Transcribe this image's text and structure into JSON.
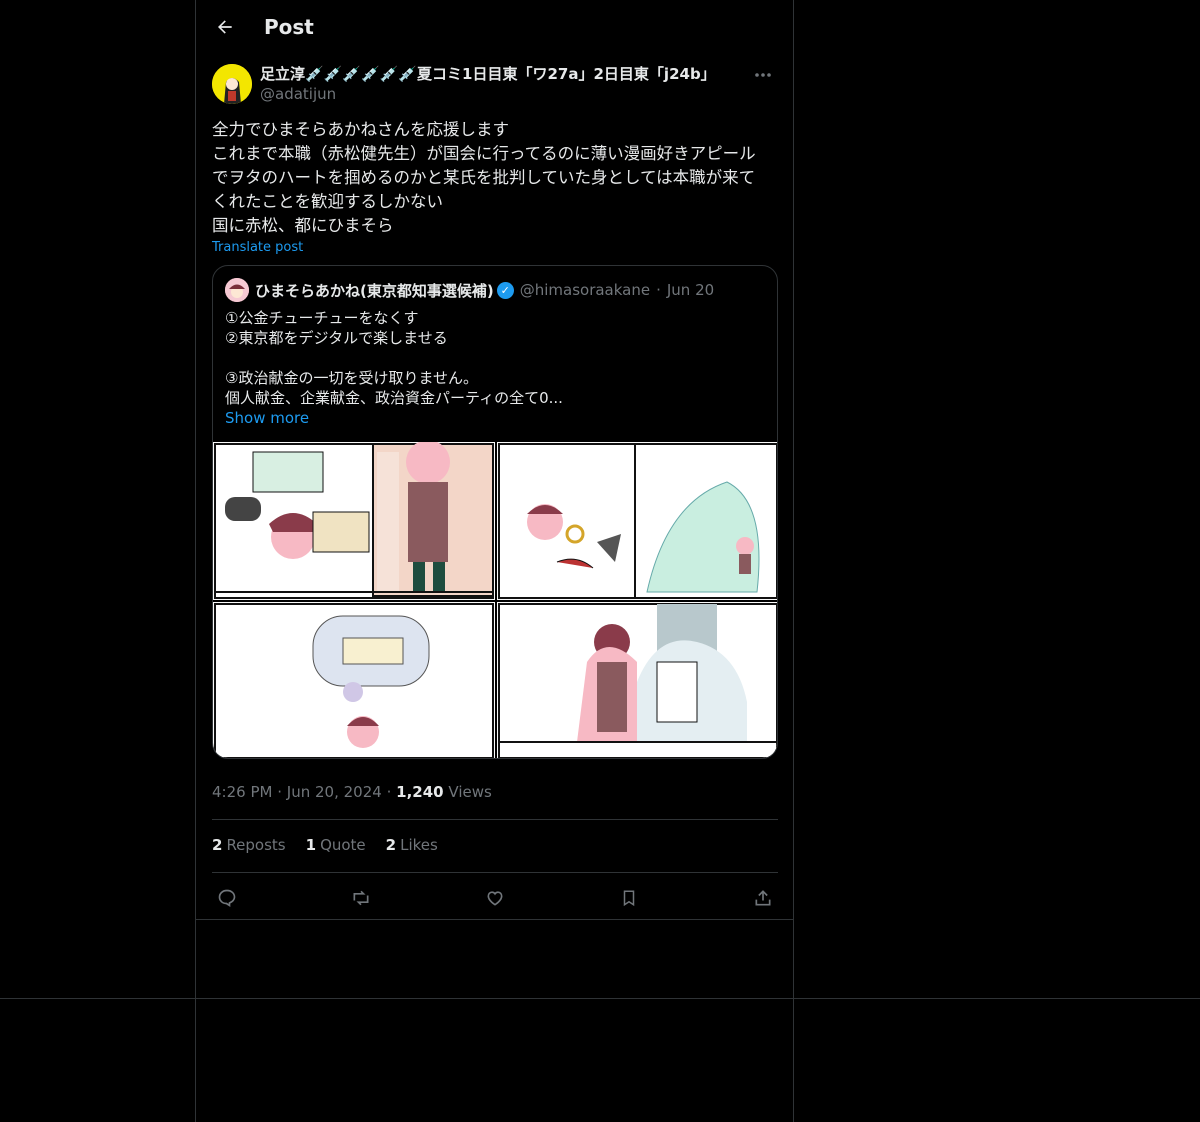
{
  "header": {
    "title": "Post"
  },
  "tweet": {
    "display_name": "足立淳💉💉💉💉💉💉夏コミ1日目東「ワ27a」2日目東「j24b」",
    "handle": "@adatijun",
    "body_lines": [
      "全力でひまそらあかねさんを応援します",
      "これまで本職（赤松健先生）が国会に行ってるのに薄い漫画好きアピール",
      "でヲタのハートを掴めるのかと某氏を批判していた身としては本職が来て",
      "くれたことを歓迎するしかない",
      "国に赤松、都にひまそら"
    ],
    "translate": "Translate post"
  },
  "quote": {
    "display_name": "ひまそらあかね(東京都知事選候補)",
    "handle": "@himasoraakane",
    "dot": "·",
    "date": "Jun 20",
    "lines": [
      "①公金チューチューをなくす",
      "②東京都をデジタルで楽しませる",
      "",
      "③政治献金の一切を受け取りません。",
      "個人献金、企業献金、政治資金パーティの全て0..."
    ],
    "show_more": "Show more"
  },
  "meta": {
    "time": "4:26 PM",
    "dot1": "·",
    "date": "Jun 20, 2024",
    "dot2": "·",
    "views_count": "1,240",
    "views_label": "Views"
  },
  "stats": {
    "reposts_count": "2",
    "reposts_label": "Reposts",
    "quotes_count": "1",
    "quotes_label": "Quote",
    "likes_count": "2",
    "likes_label": "Likes"
  },
  "colors": {
    "accent": "#1d9bf0",
    "border": "#2f3336",
    "muted": "#71767b",
    "text": "#e7e9ea"
  }
}
